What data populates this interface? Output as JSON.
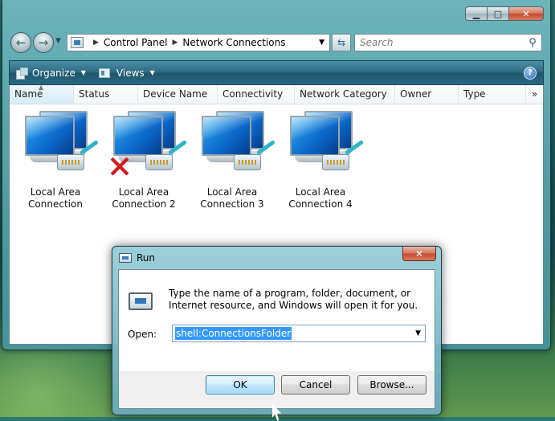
{
  "explorer": {
    "address": {
      "crumbs": [
        "Control Panel",
        "Network Connections"
      ]
    },
    "search": {
      "placeholder": "Search"
    },
    "toolbar": {
      "organize_label": "Organize",
      "views_label": "Views",
      "help_glyph": "?"
    },
    "columns": {
      "name": "Name",
      "status": "Status",
      "device_name": "Device Name",
      "connectivity": "Connectivity",
      "network_category": "Network Category",
      "owner": "Owner",
      "type": "Type",
      "more": "»"
    },
    "connections": [
      {
        "line1": "Local Area",
        "line2": "Connection",
        "disabled": false
      },
      {
        "line1": "Local Area",
        "line2": "Connection 2",
        "disabled": true
      },
      {
        "line1": "Local Area",
        "line2": "Connection 3",
        "disabled": false
      },
      {
        "line1": "Local Area",
        "line2": "Connection 4",
        "disabled": false
      }
    ]
  },
  "run_dialog": {
    "title": "Run",
    "description": "Type the name of a program, folder, document, or Internet resource, and Windows will open it for you.",
    "open_label": "Open:",
    "open_value": "shell:ConnectionsFolder",
    "buttons": {
      "ok": "OK",
      "cancel": "Cancel",
      "browse": "Browse..."
    }
  },
  "icons": {
    "window_minimize": "minimize-icon",
    "window_maximize": "maximize-icon",
    "window_close": "close-icon",
    "back": "back-arrow-icon",
    "forward": "forward-arrow-icon",
    "refresh": "refresh-icon",
    "search": "magnifier-icon",
    "help": "help-icon",
    "network_connection": "network-connection-icon",
    "disabled_marker": "red-x-icon"
  },
  "colors": {
    "selection": "#3399ff",
    "disabled_x": "#d3171b",
    "toolbar": "#2d6a82"
  }
}
